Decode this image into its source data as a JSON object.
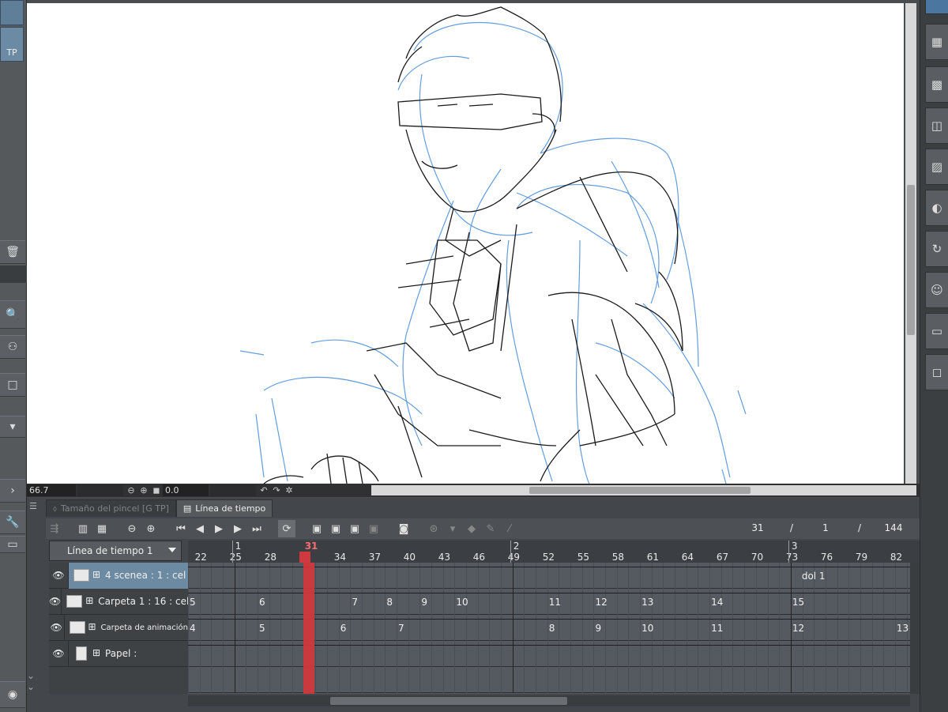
{
  "left_panel": {
    "tab_label": "TP",
    "tool_icons": [
      "trash-icon",
      "wrench-icon",
      "tools-icon"
    ]
  },
  "canvas": {
    "zoom": "66.7",
    "rotation": "0.0"
  },
  "timeline_tabs": [
    {
      "label": "Tamaño del pincel [G TP]",
      "active": false
    },
    {
      "label": "Línea de tiempo",
      "active": true
    }
  ],
  "frame_info": {
    "current": "31",
    "sep1": "/",
    "start": "1",
    "sep2": "/",
    "end": "144"
  },
  "timeline_selector": "Línea de tiempo 1",
  "ruler": {
    "numbers": [
      "22",
      "25",
      "28",
      "31",
      "34",
      "37",
      "40",
      "43",
      "46",
      "49",
      "52",
      "55",
      "58",
      "61",
      "64",
      "67",
      "70",
      "73",
      "76",
      "79",
      "82"
    ],
    "seconds": [
      "1",
      "2",
      "3"
    ],
    "current_frame": "31"
  },
  "layers": [
    {
      "name": "4 scenea : 1 : cel",
      "type": "animation",
      "selected": true
    },
    {
      "name": "Carpeta 1 : 16 : cel",
      "type": "animation",
      "selected": false
    },
    {
      "name": "Carpeta de animación",
      "type": "animation",
      "selected": false
    },
    {
      "name": "Papel :",
      "type": "paper",
      "selected": false
    }
  ],
  "tracks": [
    {
      "cels": [
        {
          "label": "dol 1",
          "frame": 73
        }
      ]
    },
    {
      "cels": [
        {
          "label": "5",
          "frame": 21
        },
        {
          "label": "6",
          "frame": 27
        },
        {
          "label": "7",
          "frame": 35
        },
        {
          "label": "8",
          "frame": 38
        },
        {
          "label": "9",
          "frame": 41
        },
        {
          "label": "10",
          "frame": 44
        },
        {
          "label": "11",
          "frame": 52
        },
        {
          "label": "12",
          "frame": 56
        },
        {
          "label": "13",
          "frame": 60
        },
        {
          "label": "14",
          "frame": 66
        },
        {
          "label": "15",
          "frame": 73
        }
      ]
    },
    {
      "cels": [
        {
          "label": "4",
          "frame": 21
        },
        {
          "label": "5",
          "frame": 27
        },
        {
          "label": "6",
          "frame": 34
        },
        {
          "label": "7",
          "frame": 39
        },
        {
          "label": "8",
          "frame": 52
        },
        {
          "label": "9",
          "frame": 56
        },
        {
          "label": "10",
          "frame": 60
        },
        {
          "label": "11",
          "frame": 66
        },
        {
          "label": "12",
          "frame": 73
        },
        {
          "label": "13",
          "frame": 82
        }
      ]
    },
    {
      "cels": []
    }
  ],
  "right_panel_icons": [
    "layer-icon",
    "layer-transparency-icon",
    "layer-stack-icon",
    "layer-mesh-icon",
    "layer-light-icon",
    "layer-transform-icon",
    "layer-user-icon",
    "folder-icon",
    "layer-paper-icon"
  ],
  "colors": {
    "playhead": "#d0393d",
    "sketch_blue": "#3d85d6",
    "selected_layer": "#6c8aa2"
  }
}
